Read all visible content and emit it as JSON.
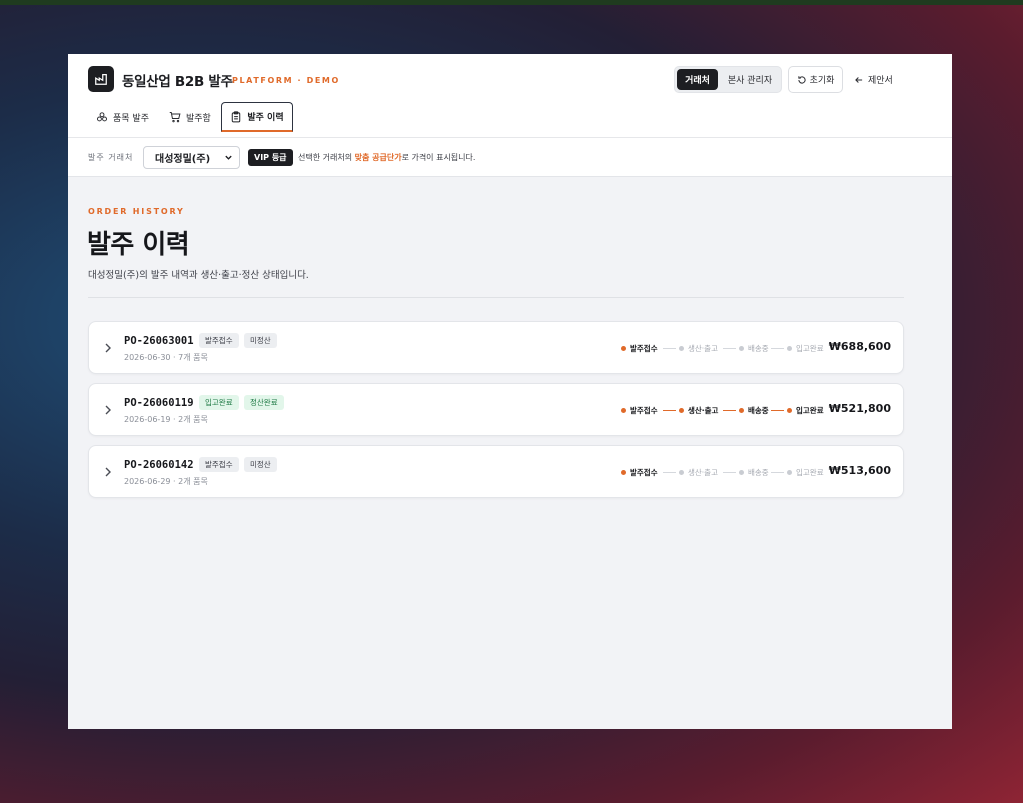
{
  "header": {
    "app_title": "동일산업 B2B 발주",
    "app_subtitle": "PLATFORM · DEMO",
    "roles": [
      "거래처",
      "본사 관리자"
    ],
    "reset_label": "초기화",
    "proposal_label": "제안서"
  },
  "tabs": [
    {
      "label": "품목 발주",
      "icon": "boxes-icon"
    },
    {
      "label": "발주함",
      "icon": "cart-icon"
    },
    {
      "label": "발주 이력",
      "icon": "clipboard-icon",
      "active": true
    }
  ],
  "subbar": {
    "label": "발주 거래처",
    "selected_client": "대성정밀(주)",
    "grade_badge": "VIP 등급",
    "notice_prefix": "선택한 거래처의 ",
    "notice_highlight": "맞춤 공급단가",
    "notice_suffix": "로 가격이 표시됩니다."
  },
  "page": {
    "eyebrow": "ORDER HISTORY",
    "title": "발주 이력",
    "description": "대성정밀(주)의 발주 내역과 생산·출고·정산 상태입니다."
  },
  "colors": {
    "accent": "#e06a2a",
    "dark": "#1d1e22",
    "green_badge": "#1f7a45"
  },
  "step_labels": [
    "발주접수",
    "생산·출고",
    "배송중",
    "입고완료"
  ],
  "orders": [
    {
      "po": "PO-26063001",
      "status": "발주접수",
      "settlement": "미정산",
      "date_items": "2026-06-30 · 7개 품목",
      "progress": 1,
      "amount": "₩688,600"
    },
    {
      "po": "PO-26060119",
      "status": "입고완료",
      "settlement": "정산완료",
      "date_items": "2026-06-19 · 2개 품목",
      "progress": 4,
      "amount": "₩521,800"
    },
    {
      "po": "PO-26060142",
      "status": "발주접수",
      "settlement": "미정산",
      "date_items": "2026-06-29 · 2개 품목",
      "progress": 1,
      "amount": "₩513,600"
    }
  ]
}
